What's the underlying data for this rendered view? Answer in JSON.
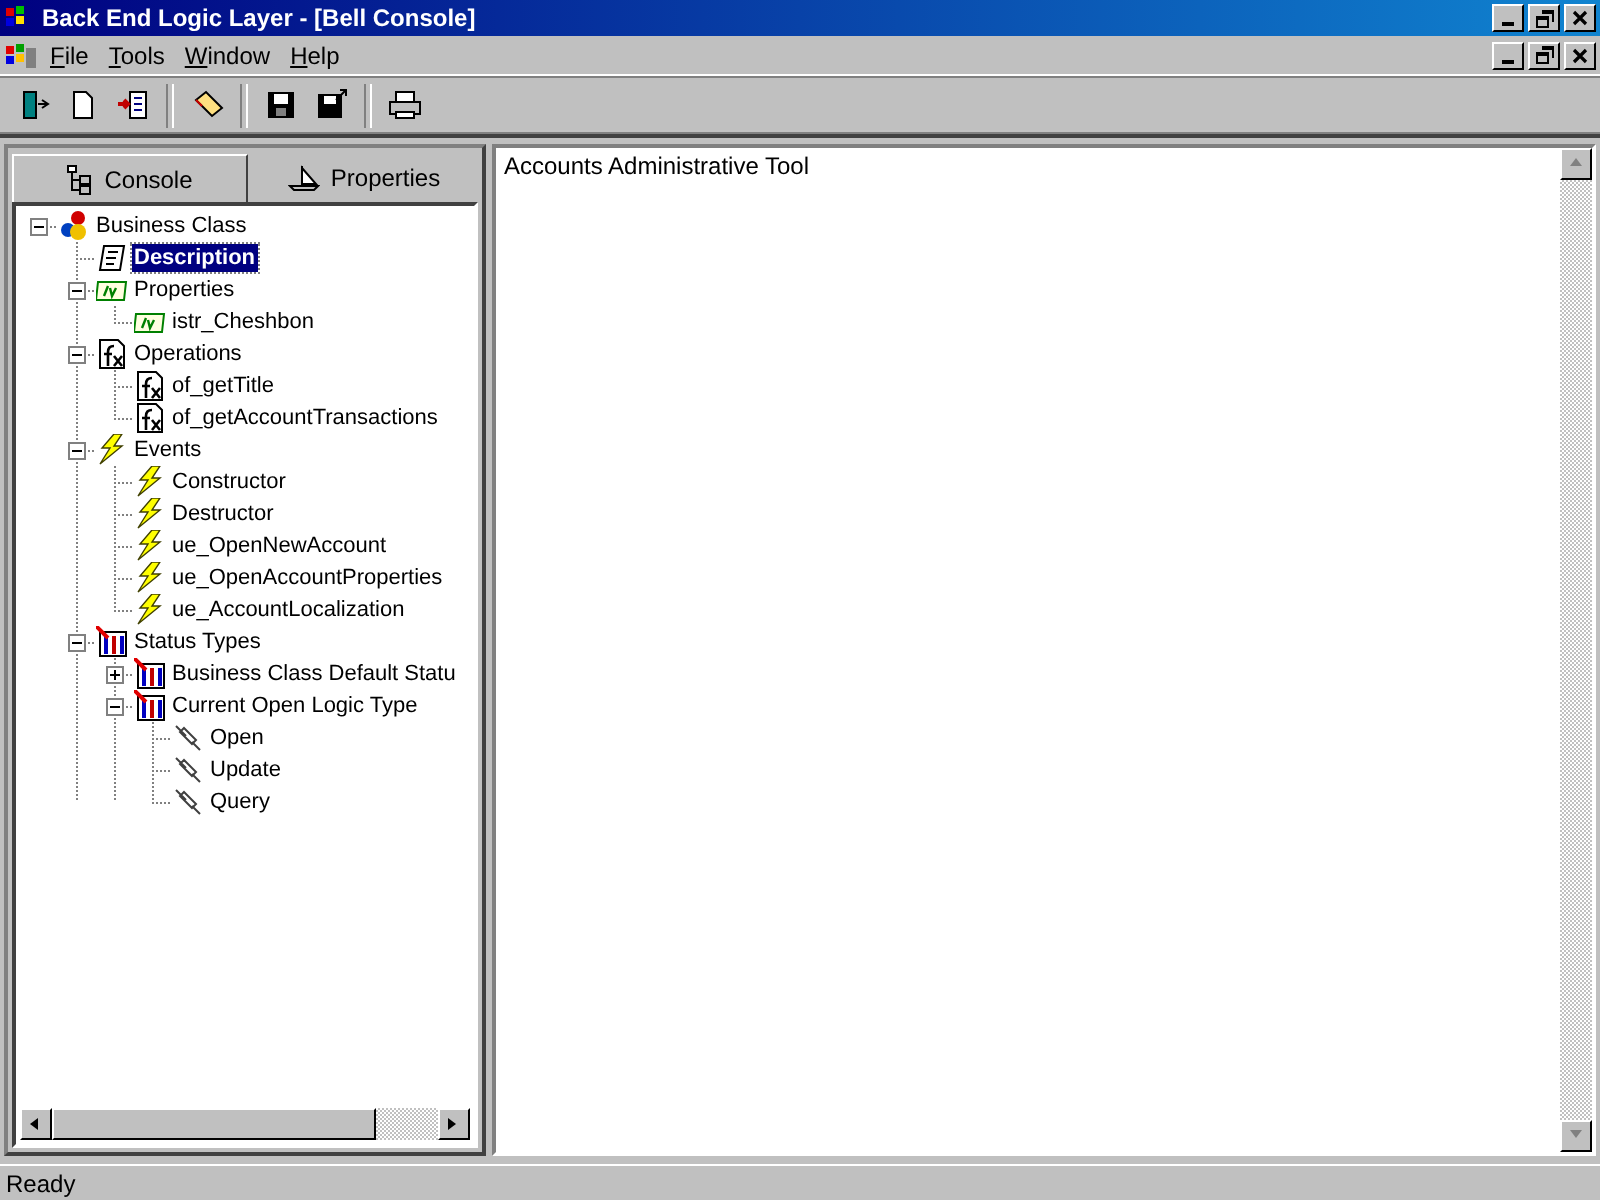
{
  "window": {
    "title": "Back End Logic Layer - [Bell Console]"
  },
  "menu": [
    "File",
    "Tools",
    "Window",
    "Help"
  ],
  "toolbar": [
    {
      "kind": "exit"
    },
    {
      "kind": "new"
    },
    {
      "kind": "import"
    },
    {
      "kind": "sep"
    },
    {
      "kind": "erase"
    },
    {
      "kind": "sep"
    },
    {
      "kind": "save"
    },
    {
      "kind": "saveas"
    },
    {
      "kind": "sep"
    },
    {
      "kind": "print"
    }
  ],
  "tabs": [
    {
      "label": "Console",
      "selected": false,
      "kind": "console"
    },
    {
      "label": "Properties",
      "selected": true,
      "kind": "properties"
    }
  ],
  "tree": [
    {
      "label": "Business Class",
      "kind": "class",
      "selected": false,
      "expanded": true,
      "children": [
        {
          "label": "Description",
          "kind": "description",
          "selected": true
        },
        {
          "label": "Properties",
          "kind": "property",
          "selected": false,
          "expanded": true,
          "children": [
            {
              "label": "istr_Cheshbon",
              "kind": "property",
              "selected": false
            }
          ]
        },
        {
          "label": "Operations",
          "kind": "operation",
          "selected": false,
          "expanded": true,
          "children": [
            {
              "label": "of_getTitle",
              "kind": "operation",
              "selected": false
            },
            {
              "label": "of_getAccountTransactions",
              "kind": "operation",
              "selected": false
            }
          ]
        },
        {
          "label": "Events",
          "kind": "event",
          "selected": false,
          "expanded": true,
          "children": [
            {
              "label": "Constructor",
              "kind": "event",
              "selected": false
            },
            {
              "label": "Destructor",
              "kind": "event",
              "selected": false
            },
            {
              "label": "ue_OpenNewAccount",
              "kind": "event",
              "selected": false
            },
            {
              "label": "ue_OpenAccountProperties",
              "kind": "event",
              "selected": false
            },
            {
              "label": "ue_AccountLocalization",
              "kind": "event",
              "selected": false
            }
          ]
        },
        {
          "label": "Status Types",
          "kind": "status",
          "selected": false,
          "expanded": true,
          "children": [
            {
              "label": "Business Class Default Statu",
              "kind": "status",
              "selected": false,
              "expanded": false
            },
            {
              "label": "Current Open Logic Type",
              "kind": "status",
              "selected": false,
              "expanded": true,
              "children": [
                {
                  "label": "Open",
                  "kind": "action",
                  "selected": false
                },
                {
                  "label": "Update",
                  "kind": "action",
                  "selected": false
                },
                {
                  "label": "Query",
                  "kind": "action",
                  "selected": false
                }
              ]
            }
          ]
        }
      ]
    }
  ],
  "content": "Accounts Administrative Tool",
  "status_bar": "Ready"
}
